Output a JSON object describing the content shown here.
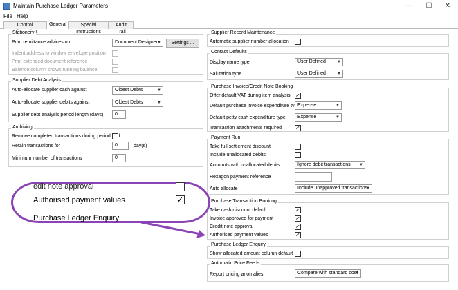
{
  "window": {
    "title": "Maintain Purchase Ledger Parameters"
  },
  "menu": [
    "File",
    "Help"
  ],
  "tabs": [
    "Control Information",
    "General",
    "Special Instructions",
    "Audit Trail"
  ],
  "stationery": {
    "title": "Stationery",
    "print_label": "Print remittance advices on",
    "print_value": "Document Designer",
    "settings_btn": "Settings ...",
    "indent": "Indent address to window envelope position",
    "extended": "Print extended document reference",
    "balance": "Balance column shows running balance"
  },
  "debt": {
    "title": "Supplier Debt Analysis",
    "cash_label": "Auto-allocate supplier cash against",
    "cash_value": "Oldest Debts",
    "debits_label": "Auto-allocate supplier debits against",
    "debits_value": "Oldest Debts",
    "period_label": "Supplier debt analysis period length (days)",
    "period_value": "0"
  },
  "archiving": {
    "title": "Archiving",
    "remove": "Remove completed transactions during period end",
    "retain": "Retain transactions for",
    "retain_value": "0",
    "retain_unit": "day(s)",
    "minimum": "Minimum number of transactions",
    "minimum_value": "0"
  },
  "record": {
    "title": "Supplier Record Maintenance",
    "auto_num": "Automatic supplier number allocation"
  },
  "contact": {
    "title": "Contact Defaults",
    "display_label": "Display name type",
    "display_value": "User Defined",
    "salutation_label": "Salutation type",
    "salutation_value": "User Defined"
  },
  "invoice": {
    "title": "Purchase Invoice/Credit Note Booking",
    "vat": "Offer default VAT during item analysis",
    "exp_label": "Default purchase invoice expenditure type",
    "exp_value": "Expense",
    "petty_label": "Default petty cash expenditure type",
    "petty_value": "Expense",
    "attach": "Transaction attachments required"
  },
  "payment": {
    "title": "Payment Run",
    "full": "Take full settlement discount",
    "unalloc": "Include unallocated debits",
    "accounts_label": "Accounts with unallocated debits",
    "accounts_value": "Ignore debit transactions",
    "hexagon": "Hexagon payment reference",
    "auto_label": "Auto allocate",
    "auto_value": "Include unapproved transactions"
  },
  "txn": {
    "title": "Purchase Transaction Booking",
    "cash_disc": "Take cash discount default",
    "inv_appr": "Invoice approved for payment",
    "credit": "Credit note approval",
    "auth": "Authorised payment values"
  },
  "enquiry": {
    "title": "Purchase Ledger Enquiry",
    "show": "Show allocated amount column default"
  },
  "price": {
    "title": "Automatic Price Feeds",
    "report_label": "Report pricing anomalies",
    "report_value": "Compare with standard cost"
  },
  "callout": {
    "line1": "edit note approval",
    "line2": "Authorised payment values",
    "line3": "Purchase Ledger Enquiry"
  },
  "colors": {
    "accent": "#8a44b5",
    "tab_border": "#bbbbbb"
  }
}
